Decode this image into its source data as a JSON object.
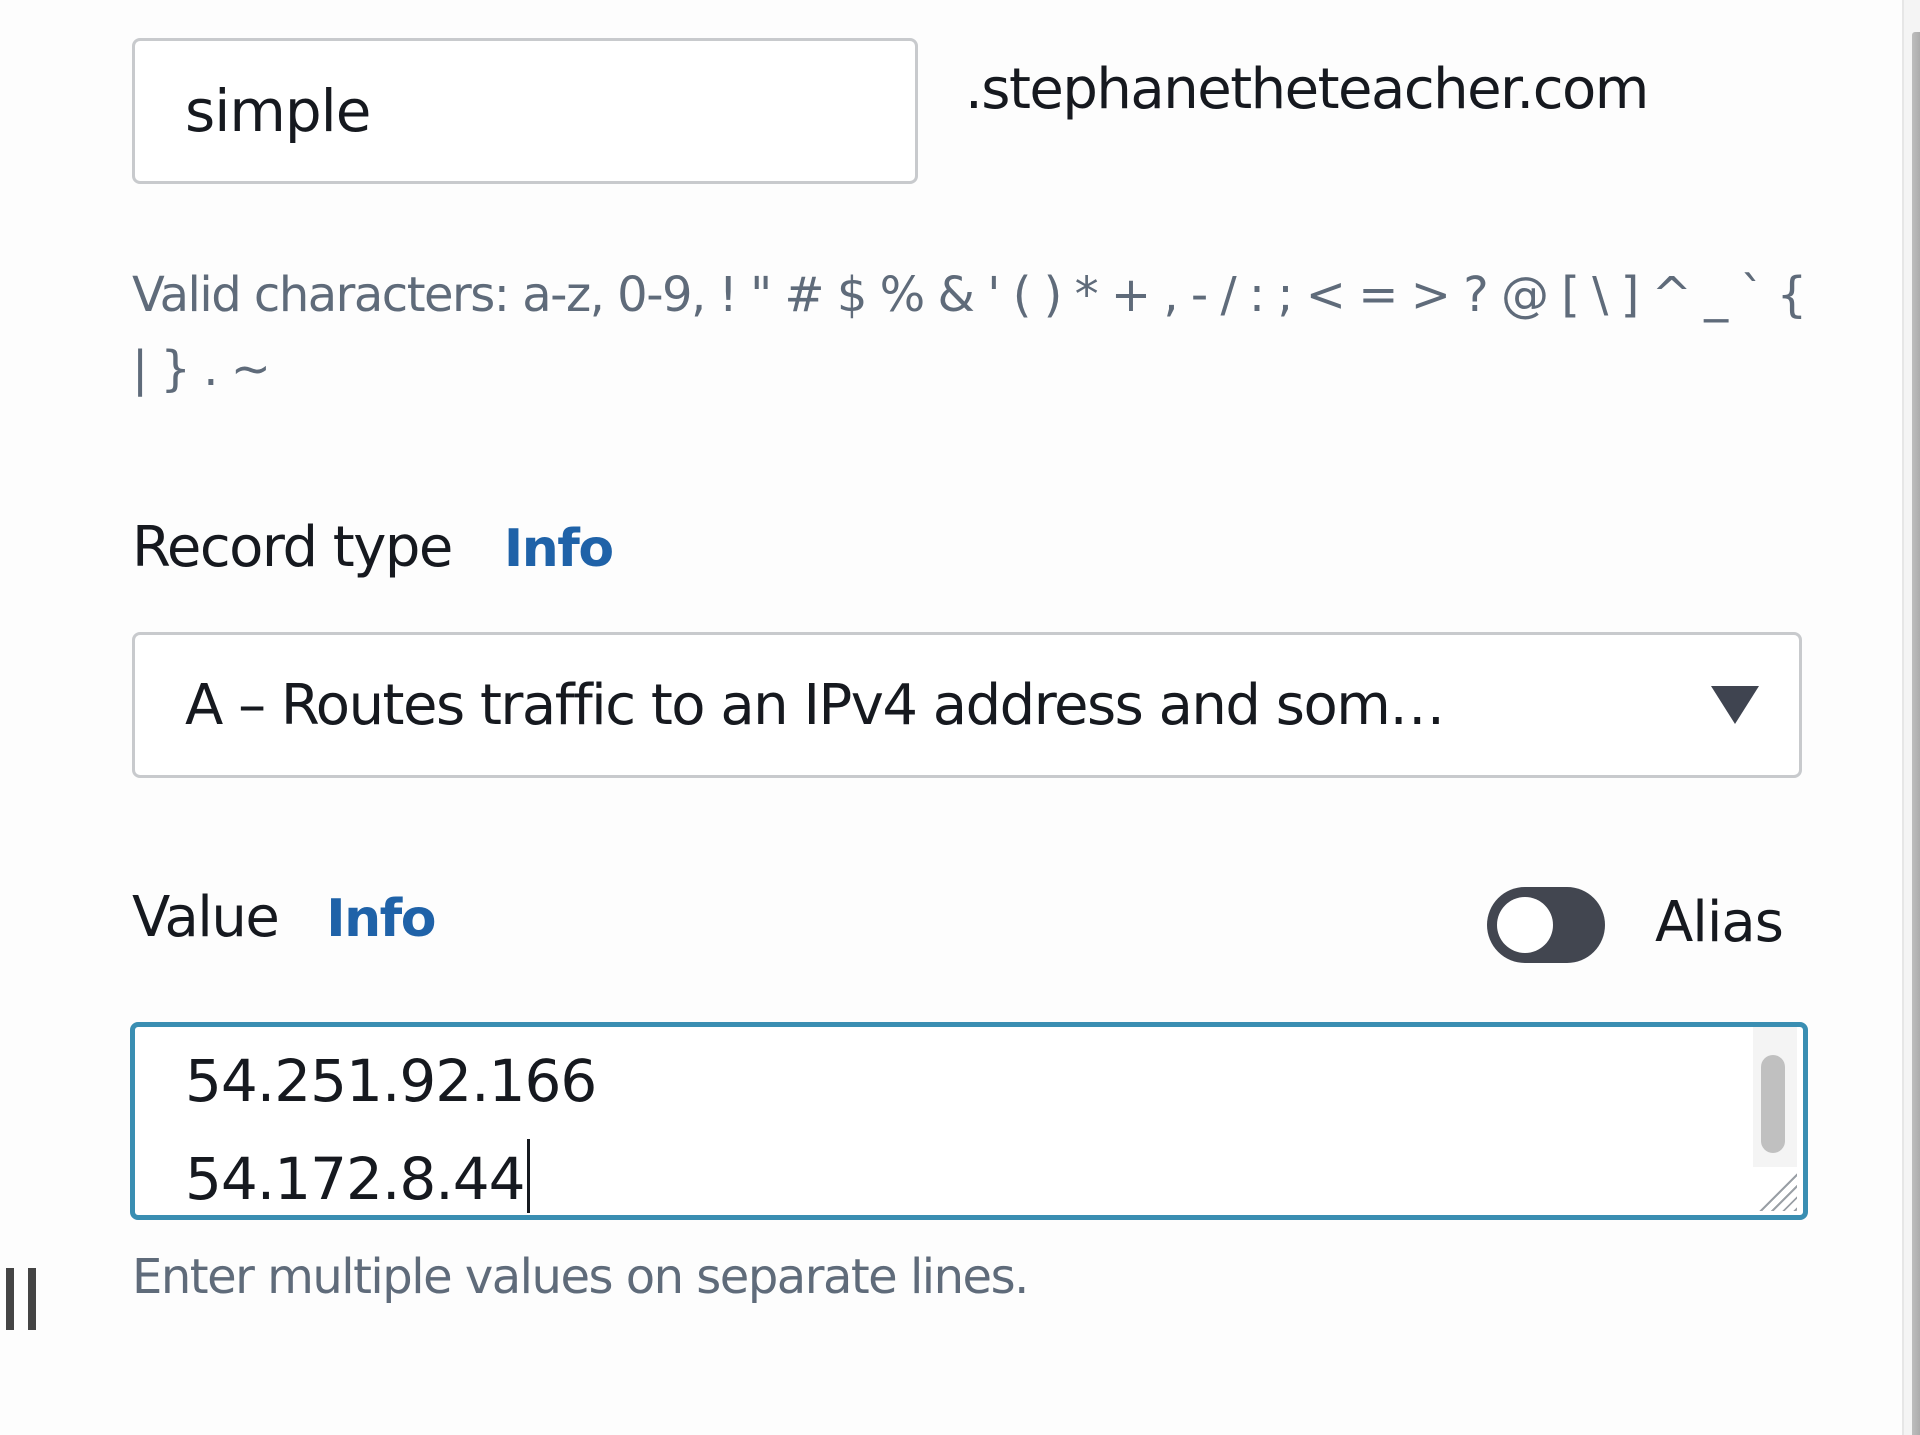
{
  "record_name": {
    "subdomain_value": "simple",
    "domain_suffix": ".stephanetheteacher.com",
    "hint": "Valid characters: a-z, 0-9, ! \" # $ % & ' ( ) * + , - / : ; < = > ? @ [ \\ ] ^ _ ` { | } . ~"
  },
  "record_type": {
    "label": "Record type",
    "info_link": "Info",
    "selected": "A – Routes traffic to an IPv4 address and som…"
  },
  "value": {
    "label": "Value",
    "info_link": "Info",
    "alias_label": "Alias",
    "alias_enabled": false,
    "lines": [
      "54.251.92.166",
      "54.172.8.44"
    ],
    "hint": "Enter multiple values on separate lines."
  },
  "colors": {
    "info_link": "#1f62a8",
    "focus_border": "#3a8eb2",
    "toggle_off": "#424650"
  }
}
